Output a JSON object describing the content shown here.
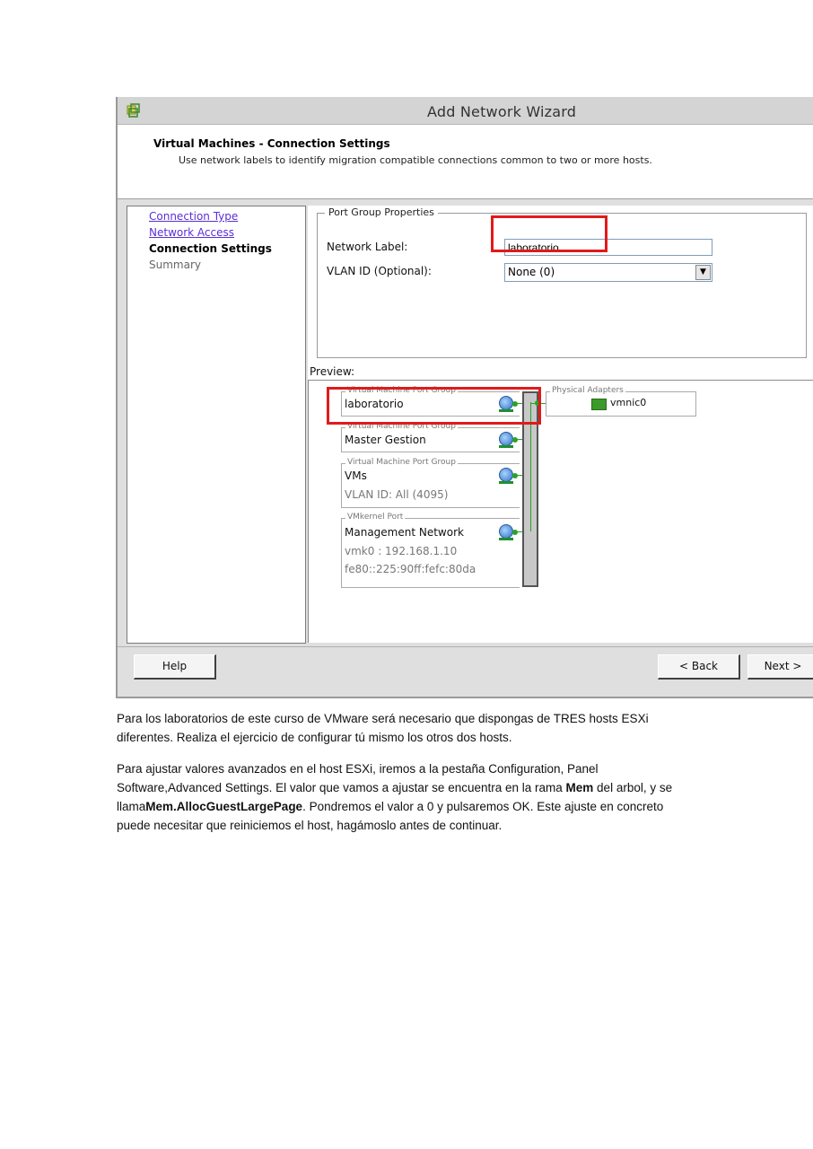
{
  "window": {
    "title": "Add Network Wizard"
  },
  "header": {
    "title": "Virtual Machines - Connection Settings",
    "description": "Use network labels to identify migration compatible connections common to two or more hosts."
  },
  "nav": {
    "items": [
      {
        "label": "Connection Type",
        "state": "link"
      },
      {
        "label": "Network Access",
        "state": "link"
      },
      {
        "label": "Connection Settings",
        "state": "current"
      },
      {
        "label": "Summary",
        "state": "inactive"
      }
    ]
  },
  "port_group_properties": {
    "legend": "Port Group Properties",
    "network_label_label": "Network Label:",
    "network_label_value": "laboratorio",
    "vlan_label": "VLAN ID (Optional):",
    "vlan_value": "None (0)"
  },
  "preview": {
    "label": "Preview:",
    "port_groups": [
      {
        "type": "Virtual Machine Port Group",
        "name": "laboratorio",
        "details": []
      },
      {
        "type": "Virtual Machine Port Group",
        "name": "Master Gestion",
        "details": []
      },
      {
        "type": "Virtual Machine Port Group",
        "name": "VMs",
        "details": [
          "VLAN ID: All (4095)"
        ]
      },
      {
        "type": "VMkernel Port",
        "name": "Management Network",
        "details": [
          "vmk0 : 192.168.1.10",
          "fe80::225:90ff:fefc:80da"
        ]
      }
    ],
    "physical_adapters": {
      "legend": "Physical Adapters",
      "nic": "vmnic0"
    }
  },
  "footer": {
    "help": "Help",
    "back": "< Back",
    "next": "Next >"
  },
  "text": {
    "p1": "Para los laboratorios de este curso de VMware será necesario que dispongas de TRES hosts ESXi diferentes. Realiza el ejercicio de configurar tú mismo los otros dos hosts.",
    "p2_a": "Para ajustar valores avanzados en el host ESXi, iremos a la pestaña Configuration, Panel Software,Advanced Settings. El valor que vamos a ajustar se encuentra en la rama ",
    "p2_b": "Mem",
    "p2_c": " del arbol, y se llama",
    "p2_d": "Mem.AllocGuestLargePage",
    "p2_e": ". Pondremos el valor a 0 y pulsaremos OK. Este ajuste en concreto puede necesitar que reiniciemos el host, hagámoslo antes de continuar."
  }
}
